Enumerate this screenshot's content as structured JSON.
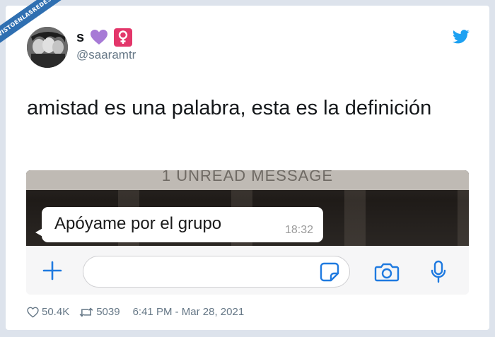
{
  "watermark": {
    "text": "VISTOENLASREDES"
  },
  "tweet": {
    "display_name": "s",
    "emojis": [
      "purple-heart",
      "female-sign"
    ],
    "username": "@saaramtr",
    "text": "amistad es una palabra, esta es la definición",
    "likes": "50.4K",
    "retweets": "5039",
    "timestamp": "6:41 PM - Mar 28, 2021"
  },
  "media": {
    "unread_banner": "1 UNREAD MESSAGE",
    "message": {
      "text": "Apóyame por el grupo",
      "time": "18:32"
    },
    "input": {
      "placeholder": ""
    }
  },
  "colors": {
    "twitter_blue": "#1da1f2",
    "whatsapp_blue": "#1f7ae0",
    "heart_purple": "#a77ad6",
    "female_pink": "#e3366a"
  }
}
